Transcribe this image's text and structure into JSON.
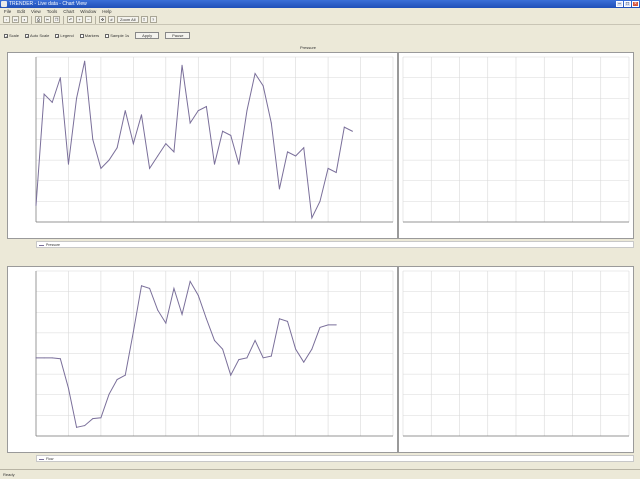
{
  "window": {
    "title": "TRENDER - Live data - Chart View"
  },
  "menu": [
    "File",
    "Edit",
    "View",
    "Tools",
    "Chart",
    "Window",
    "Help"
  ],
  "toolbar": {
    "buttons": [
      "new",
      "open",
      "save",
      "print",
      "cut",
      "copy",
      "paste",
      "undo",
      "zoom-in",
      "zoom-out",
      "pan",
      "grid",
      "export",
      "help"
    ],
    "zoom_label": "Zoom All"
  },
  "options": {
    "items": [
      {
        "label": "Scale",
        "checked": true
      },
      {
        "label": "Auto Scale",
        "checked": true
      },
      {
        "label": "Legend",
        "checked": true
      },
      {
        "label": "Markers",
        "checked": false
      },
      {
        "label": "Sample 1s",
        "checked": false
      }
    ],
    "apply_label": "Apply",
    "pause_label": "Pause"
  },
  "colors": {
    "series": "#7a6f9a",
    "grid": "#d8d8d8",
    "window_title": "#2b5fc9"
  },
  "status": {
    "text": "Ready"
  },
  "chart_data": [
    {
      "type": "line",
      "title": "Pressure",
      "x": [
        0,
        1,
        2,
        3,
        4,
        5,
        6,
        7,
        8,
        9,
        10,
        11,
        12,
        13,
        14,
        15,
        16,
        17,
        18,
        19,
        20,
        21,
        22,
        23,
        24,
        25,
        26,
        27,
        28,
        29,
        30,
        31,
        32,
        33,
        34,
        35,
        36,
        37,
        38,
        39
      ],
      "series": [
        {
          "name": "Pressure",
          "values": [
            95.4,
            98.1,
            97.9,
            98.5,
            96.4,
            98.0,
            98.9,
            97.0,
            96.3,
            96.5,
            96.8,
            97.7,
            96.9,
            97.6,
            96.3,
            96.6,
            96.9,
            96.7,
            98.8,
            97.4,
            97.7,
            97.8,
            96.4,
            97.2,
            97.1,
            96.4,
            97.7,
            98.6,
            98.3,
            97.4,
            95.8,
            96.7,
            96.6,
            96.8,
            95.1,
            95.5,
            96.3,
            96.2,
            97.3,
            97.2
          ]
        }
      ],
      "ylim": [
        95,
        99
      ],
      "xlim": [
        0,
        44
      ],
      "grid": true,
      "legend": "bottom-left"
    },
    {
      "type": "line",
      "title": "",
      "x": [
        0,
        1,
        2,
        3,
        4,
        5,
        6,
        7,
        8,
        9,
        10,
        11,
        12,
        13,
        14,
        15,
        16,
        17,
        18,
        19,
        20,
        21,
        22,
        23,
        24,
        25,
        26,
        27,
        28,
        29,
        30,
        31,
        32,
        33,
        34,
        35,
        36,
        37
      ],
      "series": [
        {
          "name": "Flow",
          "values": [
            36.0,
            36.0,
            36.0,
            35.9,
            32.5,
            28.0,
            28.2,
            29.0,
            29.1,
            31.8,
            33.5,
            34.0,
            39.0,
            44.3,
            44.0,
            41.5,
            40.0,
            44.0,
            41.0,
            44.8,
            43.2,
            40.5,
            38.0,
            37.0,
            34.0,
            35.8,
            36.0,
            38.0,
            36.0,
            36.2,
            40.5,
            40.2,
            37.0,
            35.5,
            37.0,
            39.5,
            39.8,
            39.8
          ]
        }
      ],
      "ylim": [
        27,
        46
      ],
      "xlim": [
        0,
        44
      ],
      "grid": true,
      "legend": "bottom-left"
    }
  ]
}
